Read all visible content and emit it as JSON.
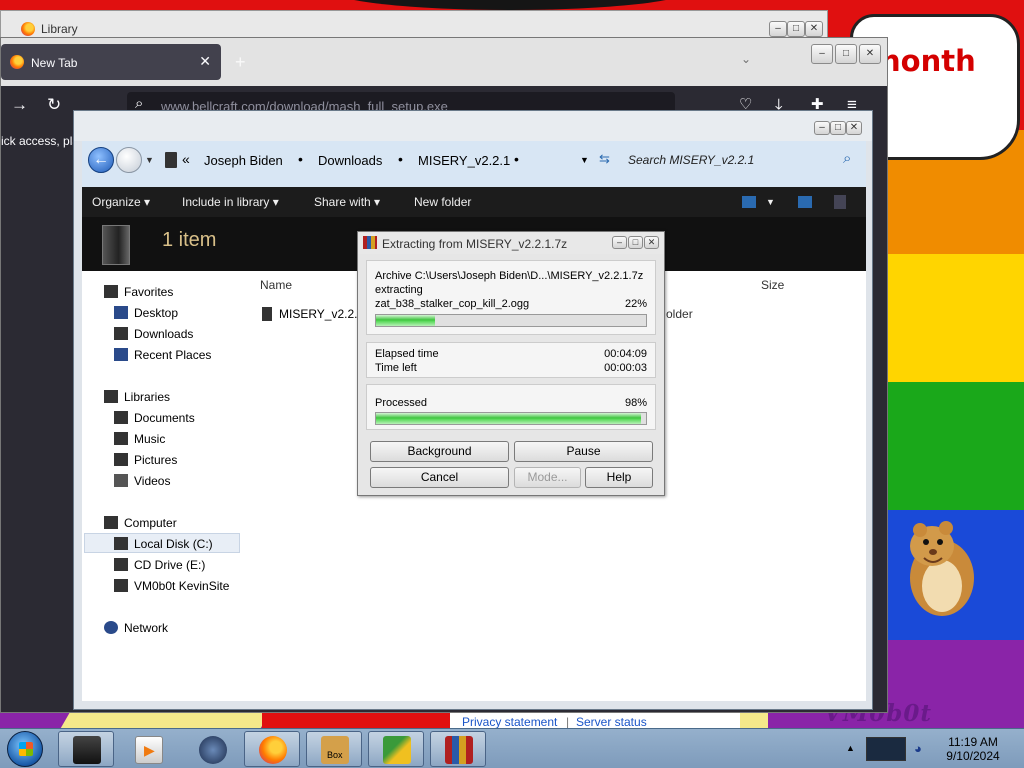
{
  "wallpaper": {
    "bubble_text": "nonth",
    "watermark": "VM0b0t",
    "footer_links": [
      "Privacy statement",
      "Server status"
    ]
  },
  "library_window": {
    "title": "Library"
  },
  "firefox": {
    "tab_label": "New Tab",
    "url": "www.bellcraft.com/download/mash_full_setup.exe",
    "side_text": "ick access, pla"
  },
  "explorer": {
    "breadcrumb": [
      "Joseph Biden",
      "Downloads",
      "MISERY_v2.2.1"
    ],
    "search_placeholder": "Search MISERY_v2.2.1",
    "commands": [
      "Organize",
      "Include in library",
      "Share with",
      "New folder"
    ],
    "item_count": "1 item",
    "sidebar": {
      "favorites": {
        "label": "Favorites",
        "items": [
          "Desktop",
          "Downloads",
          "Recent Places"
        ]
      },
      "libraries": {
        "label": "Libraries",
        "items": [
          "Documents",
          "Music",
          "Pictures",
          "Videos"
        ]
      },
      "computer": {
        "label": "Computer",
        "items": [
          "Local Disk (C:)",
          "CD Drive (E:)",
          "VM0b0t KevinSite"
        ]
      },
      "network": {
        "label": "Network"
      }
    },
    "columns": {
      "name": "Name",
      "size": "Size"
    },
    "files": [
      {
        "name": "MISERY_v2.2.1",
        "type": "older"
      }
    ]
  },
  "zip_dialog": {
    "title": "Extracting from MISERY_v2.2.1.7z",
    "archive_line": "Archive C:\\Users\\Joseph Biden\\D...\\MISERY_v2.2.1.7z",
    "action": "extracting",
    "current_file": "zat_b38_stalker_cop_kill_2.ogg",
    "file_percent": "22%",
    "file_progress": 0.22,
    "elapsed_label": "Elapsed time",
    "elapsed_value": "00:04:09",
    "left_label": "Time left",
    "left_value": "00:00:03",
    "processed_label": "Processed",
    "processed_percent": "98%",
    "processed_progress": 0.98,
    "buttons": {
      "background": "Background",
      "pause": "Pause",
      "cancel": "Cancel",
      "mode": "Mode...",
      "help": "Help"
    }
  },
  "taskbar": {
    "time": "11:19 AM",
    "date": "9/10/2024",
    "box_label": "Box"
  }
}
